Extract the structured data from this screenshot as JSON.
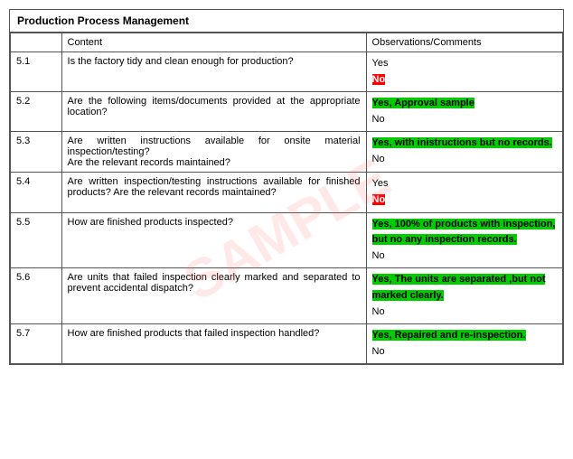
{
  "table": {
    "title": "Production Process Management",
    "headers": {
      "num": "",
      "content": "Content",
      "observations": "Observations/Comments"
    },
    "rows": [
      {
        "num": "5.1",
        "content": "Is the factory tidy and clean enough for production?",
        "observations": [
          {
            "text": "Yes",
            "style": "plain"
          },
          {
            "text": "No",
            "style": "red"
          }
        ]
      },
      {
        "num": "5.2",
        "content": "Are the following items/documents provided at the appropriate location?",
        "observations": [
          {
            "text": "Yes, Approval sample",
            "style": "green"
          },
          {
            "text": "No",
            "style": "plain"
          }
        ]
      },
      {
        "num": "5.3",
        "content": "Are written instructions available for onsite material inspection/testing?\nAre the relevant records maintained?",
        "observations": [
          {
            "text": "Yes, with inistructions but no records.",
            "style": "green"
          },
          {
            "text": "No",
            "style": "plain"
          }
        ]
      },
      {
        "num": "5.4",
        "content": "Are written inspection/testing instructions available for finished products? Are the relevant records maintained?",
        "observations": [
          {
            "text": "Yes",
            "style": "plain"
          },
          {
            "text": "No",
            "style": "red"
          }
        ]
      },
      {
        "num": "5.5",
        "content": "How are finished products inspected?",
        "observations": [
          {
            "text": "Yes, 100% of products with inspection, but no any inspection records.",
            "style": "green"
          },
          {
            "text": "No",
            "style": "plain"
          }
        ]
      },
      {
        "num": "5.6",
        "content": "Are units that failed inspection clearly marked and separated to prevent accidental dispatch?",
        "observations": [
          {
            "text": "Yes, The units are separated ,but not marked clearly.",
            "style": "green"
          },
          {
            "text": "No",
            "style": "plain"
          }
        ]
      },
      {
        "num": "5.7",
        "content": "How are finished products that failed inspection handled?",
        "observations": [
          {
            "text": "Yes, Repaired and re-inspection.",
            "style": "green"
          },
          {
            "text": "No",
            "style": "plain"
          }
        ]
      }
    ]
  }
}
